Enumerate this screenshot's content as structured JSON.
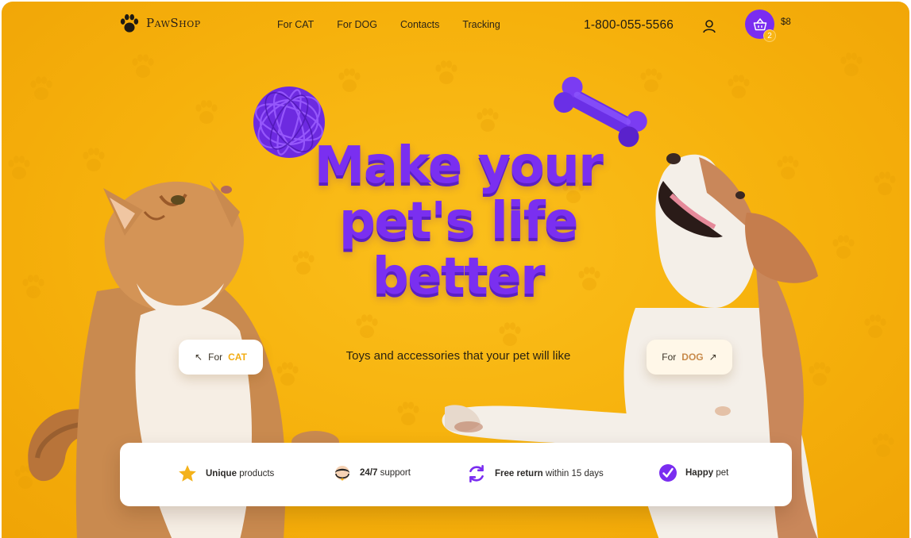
{
  "brand": {
    "name": "PawShop",
    "logo_icon": "paw-icon"
  },
  "nav": {
    "items": [
      {
        "label": "For CAT"
      },
      {
        "label": "For DOG"
      },
      {
        "label": "Contacts"
      },
      {
        "label": "Tracking"
      }
    ],
    "phone": "1-800-055-5566",
    "user_icon": "user-icon",
    "cart": {
      "icon": "basket-icon",
      "count": "2",
      "total": "$8"
    }
  },
  "hero": {
    "headline": [
      "Make your",
      "pet's life",
      "better"
    ],
    "tagline": "Toys and accessories that your pet will like",
    "cat_button": {
      "prefix": "For",
      "highlight": "CAT",
      "icon": "arrow-up-left-icon"
    },
    "dog_button": {
      "prefix": "For",
      "highlight": "DOG",
      "icon": "arrow-up-right-icon"
    }
  },
  "features": [
    {
      "icon": "star-icon",
      "bold": "Unique",
      "rest": "products"
    },
    {
      "icon": "support-agent-icon",
      "bold": "24/7",
      "rest": "support"
    },
    {
      "icon": "refresh-icon",
      "bold": "Free return",
      "rest": "within 15 days"
    },
    {
      "icon": "check-icon",
      "bold": "Happy",
      "rest": "pet"
    }
  ],
  "colors": {
    "accent": "#7a2df0",
    "background": "#f6b10c",
    "highlight": "#f2ac12"
  }
}
